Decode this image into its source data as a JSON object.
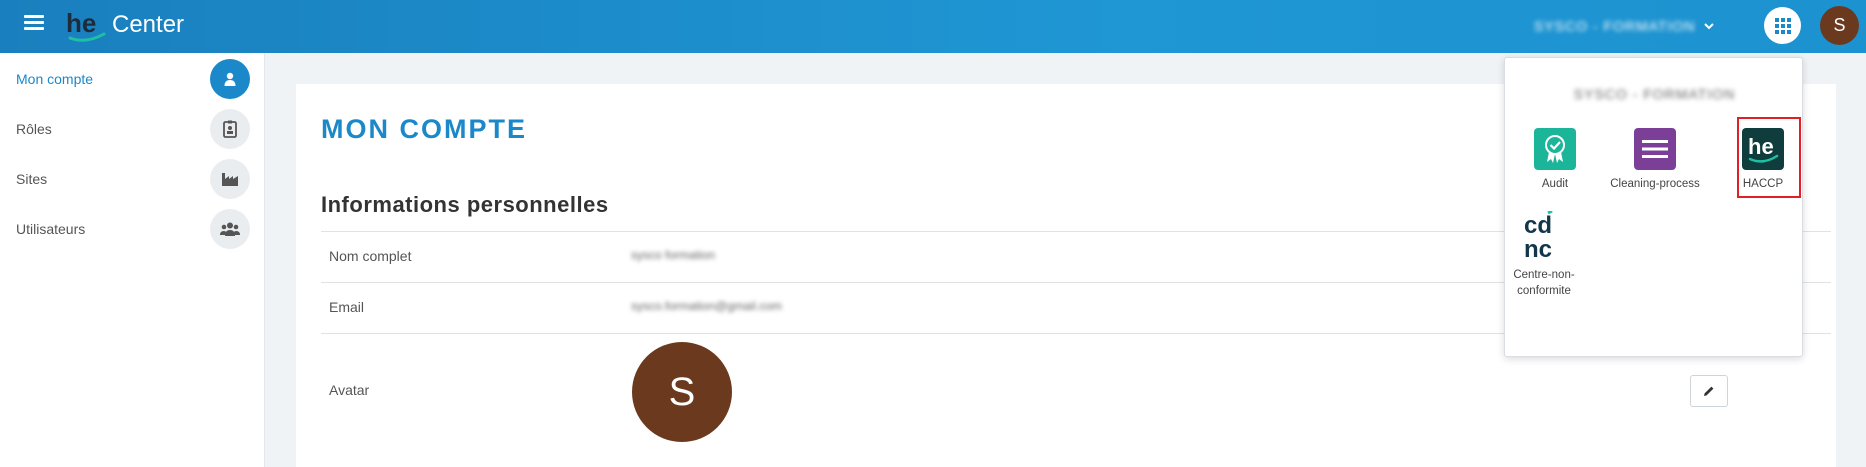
{
  "header": {
    "app_title": "Center",
    "logo_text": "he",
    "company_name": "SYSCO - FORMATION",
    "user_initial": "S",
    "icons": {
      "menu": "hamburger-icon",
      "apps": "grid-icon",
      "chevron": "chevron-down-icon"
    }
  },
  "sidebar": {
    "items": [
      {
        "label": "Mon compte",
        "icon": "user-icon",
        "active": true
      },
      {
        "label": "Rôles",
        "icon": "badge-icon",
        "active": false
      },
      {
        "label": "Sites",
        "icon": "factory-icon",
        "active": false
      },
      {
        "label": "Utilisateurs",
        "icon": "users-icon",
        "active": false
      }
    ]
  },
  "main": {
    "page_title": "MON COMPTE",
    "section_title": "Informations personnelles",
    "fields": [
      {
        "label": "Nom complet",
        "value": "sysco formation"
      },
      {
        "label": "Email",
        "value": "sysco.formation@gmail.com"
      },
      {
        "label": "Avatar",
        "value": ""
      }
    ],
    "avatar_initial": "S",
    "edit_icon": "pencil-icon"
  },
  "app_switcher": {
    "company_name": "SYSCO - FORMATION",
    "apps": [
      {
        "name": "Audit",
        "icon": "audit-badge-icon",
        "color": "#1bb59a"
      },
      {
        "name": "Cleaning-process",
        "icon": "list-icon",
        "color": "#7b3f97"
      },
      {
        "name": "HACCP",
        "icon": "he-logo-icon",
        "color": "#0f3c3c",
        "highlighted": true
      },
      {
        "name_line1": "Centre-non-",
        "name_line2": "conformite",
        "icon": "cdnc-logo-icon",
        "color": "#13364a"
      }
    ]
  },
  "colors": {
    "accent": "#1a88c9",
    "avatar": "#6b3a1e",
    "highlight": "#e01f26"
  }
}
